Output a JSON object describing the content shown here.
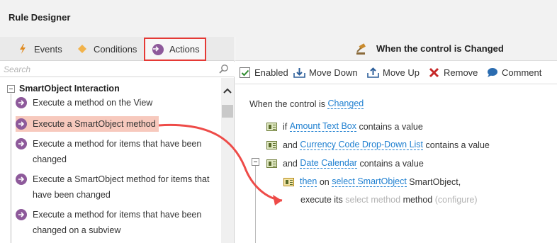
{
  "window": {
    "title": "Rule Designer"
  },
  "left_panel": {
    "tabs": [
      {
        "label": "Events",
        "icon": "lightning-icon"
      },
      {
        "label": "Conditions",
        "icon": "diamond-icon"
      },
      {
        "label": "Actions",
        "icon": "arrow-circle-icon",
        "selected": true
      }
    ],
    "search": {
      "placeholder": "Search",
      "value": ""
    },
    "group": {
      "label": "SmartObject Interaction",
      "expanded": true
    },
    "items": [
      {
        "label": "Execute a method on the View"
      },
      {
        "label": "Execute a SmartObject method",
        "selected": true
      },
      {
        "line1": "Execute a method for items that have been",
        "line2": "changed"
      },
      {
        "line1": "Execute a SmartObject method for items that",
        "line2": "have been changed"
      },
      {
        "line1": "Execute a method for items that have been",
        "line2": "changed on a subview"
      }
    ]
  },
  "right_panel": {
    "header": {
      "title": "When the control is Changed"
    },
    "toolbar": {
      "enabled": {
        "label": "Enabled",
        "checked": true
      },
      "move_down": "Move Down",
      "move_up": "Move Up",
      "remove": "Remove",
      "comment": "Comment"
    },
    "rule": {
      "event_prefix": "When the control is",
      "event_link": "Changed",
      "conditions": [
        {
          "prefix": "if",
          "link": "Amount Text Box",
          "suffix": "contains a value"
        },
        {
          "prefix": "and",
          "link": "Currency Code Drop-Down List",
          "suffix": "contains a value"
        },
        {
          "prefix": "and",
          "link": "Date Calendar",
          "suffix": "contains a value"
        }
      ],
      "action": {
        "then_link": "then",
        "on_text": "on",
        "smartobject_link": "select SmartObject",
        "smartobject_suffix": "SmartObject,",
        "execute_prefix": "execute its",
        "method_placeholder": "select method",
        "method_word": "method",
        "configure": "(configure)"
      }
    }
  },
  "colors": {
    "accent_link": "#1e7fd0",
    "action_icon": "#8e5a9b",
    "highlight": "#e53935",
    "selected_row": "#f7c9bd"
  }
}
